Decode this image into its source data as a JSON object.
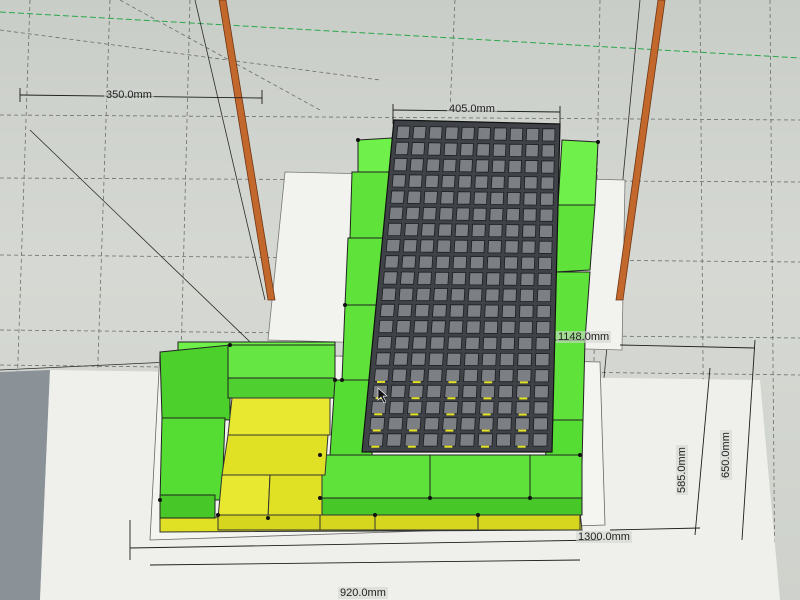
{
  "window": {
    "app": "3D modeling viewport"
  },
  "dimensions": {
    "left_width": "350.0mm",
    "top_width": "405.0mm",
    "right_height": "1148.0mm",
    "inner_depth": "585.0mm",
    "outer_depth": "650.0mm",
    "bottom_width": "1300.0mm",
    "overall_width": "920.0mm"
  },
  "colors": {
    "green_block": "#5fe33b",
    "yellow_block": "#e3e324",
    "tray_dark": "#4d5054",
    "cell": "#7c7f84",
    "rod": "#c2682d",
    "floor": "#f2f2ef"
  },
  "tray": {
    "columns": 10,
    "rows": 20
  }
}
